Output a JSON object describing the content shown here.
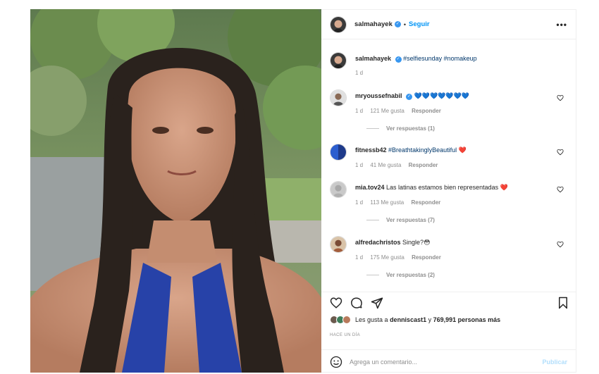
{
  "post": {
    "username": "salmahayek",
    "follow_label": "Seguir",
    "more_glyph": "•••",
    "dot": "•"
  },
  "caption": {
    "username": "salmahayek",
    "text": "#selfiesunday #nomakeup",
    "age": "1 d"
  },
  "comments": [
    {
      "username": "mryoussefnabil",
      "text": "💙💙💙💙💙💙💙",
      "age": "1 d",
      "likes": "121 Me gusta",
      "reply": "Responder",
      "replies": "Ver respuestas (1)",
      "verified": true
    },
    {
      "username": "fitnessb42",
      "text": "#BreathtakinglyBeautiful ❤️",
      "age": "1 d",
      "likes": "41 Me gusta",
      "reply": "Responder",
      "replies": ""
    },
    {
      "username": "mia.tov24",
      "text": "Las latinas estamos bien representadas ❤️",
      "age": "1 d",
      "likes": "113 Me gusta",
      "reply": "Responder",
      "replies": "Ver respuestas (7)"
    },
    {
      "username": "alfredachristos",
      "text": "Single?😳",
      "age": "1 d",
      "likes": "175 Me gusta",
      "reply": "Responder",
      "replies": "Ver respuestas (2)"
    }
  ],
  "likes": {
    "prefix": "Les gusta a",
    "user": "denniscast1",
    "middle": "y",
    "count": "769,991 personas más"
  },
  "time_ago": "HACE UN DÍA",
  "comment_box": {
    "placeholder": "Agrega un comentario...",
    "publish_label": "Publicar"
  },
  "colors": {
    "accent": "#0095f6",
    "verified": "#3897f0",
    "heart": "#ed4956",
    "hashtag": "#00376b"
  },
  "icons": [
    "heart-icon",
    "comment-icon",
    "share-icon",
    "bookmark-icon",
    "emoji-icon",
    "more-icon",
    "verified-icon"
  ]
}
